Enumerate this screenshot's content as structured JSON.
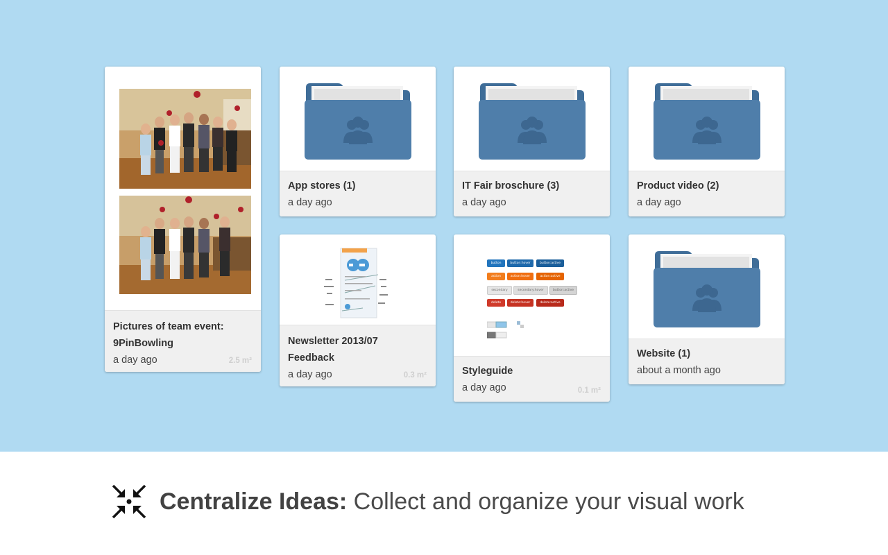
{
  "colors": {
    "background": "#b0daf2",
    "folder": "#4f7eaa",
    "card_meta": "#f0f0f0"
  },
  "cards": [
    {
      "title": "Pictures of team event:",
      "title2": "9PinBowling",
      "time": "a day ago",
      "size": "2.5 m²",
      "kind": "photos"
    },
    {
      "title": "App stores (1)",
      "time": "a day ago",
      "kind": "folder",
      "icon": "shared-folder-icon"
    },
    {
      "title": "IT Fair broschure (3)",
      "time": "a day ago",
      "kind": "folder",
      "icon": "shared-folder-icon"
    },
    {
      "title": "Product video (2)",
      "time": "a day ago",
      "kind": "folder",
      "icon": "shared-folder-icon"
    },
    {
      "title": "Newsletter 2013/07",
      "title2": "Feedback",
      "time": "a day ago",
      "size": "0.3 m²",
      "kind": "sketch"
    },
    {
      "title": "Styleguide",
      "time": "a day ago",
      "size": "0.1 m²",
      "kind": "styleguide",
      "buttons": [
        "button",
        "button:hover",
        "button:active",
        "action",
        "action:hover",
        "action:active",
        "secondary",
        "secondary:hover",
        "button:active",
        "delete",
        "delete:hover",
        "delete:active"
      ]
    },
    {
      "title": "Website (1)",
      "time": "about a month ago",
      "kind": "folder",
      "icon": "shared-folder-icon"
    }
  ],
  "footer": {
    "icon": "collapse-arrows-icon",
    "bold": "Centralize Ideas:",
    "text": " Collect and organize your visual work"
  }
}
